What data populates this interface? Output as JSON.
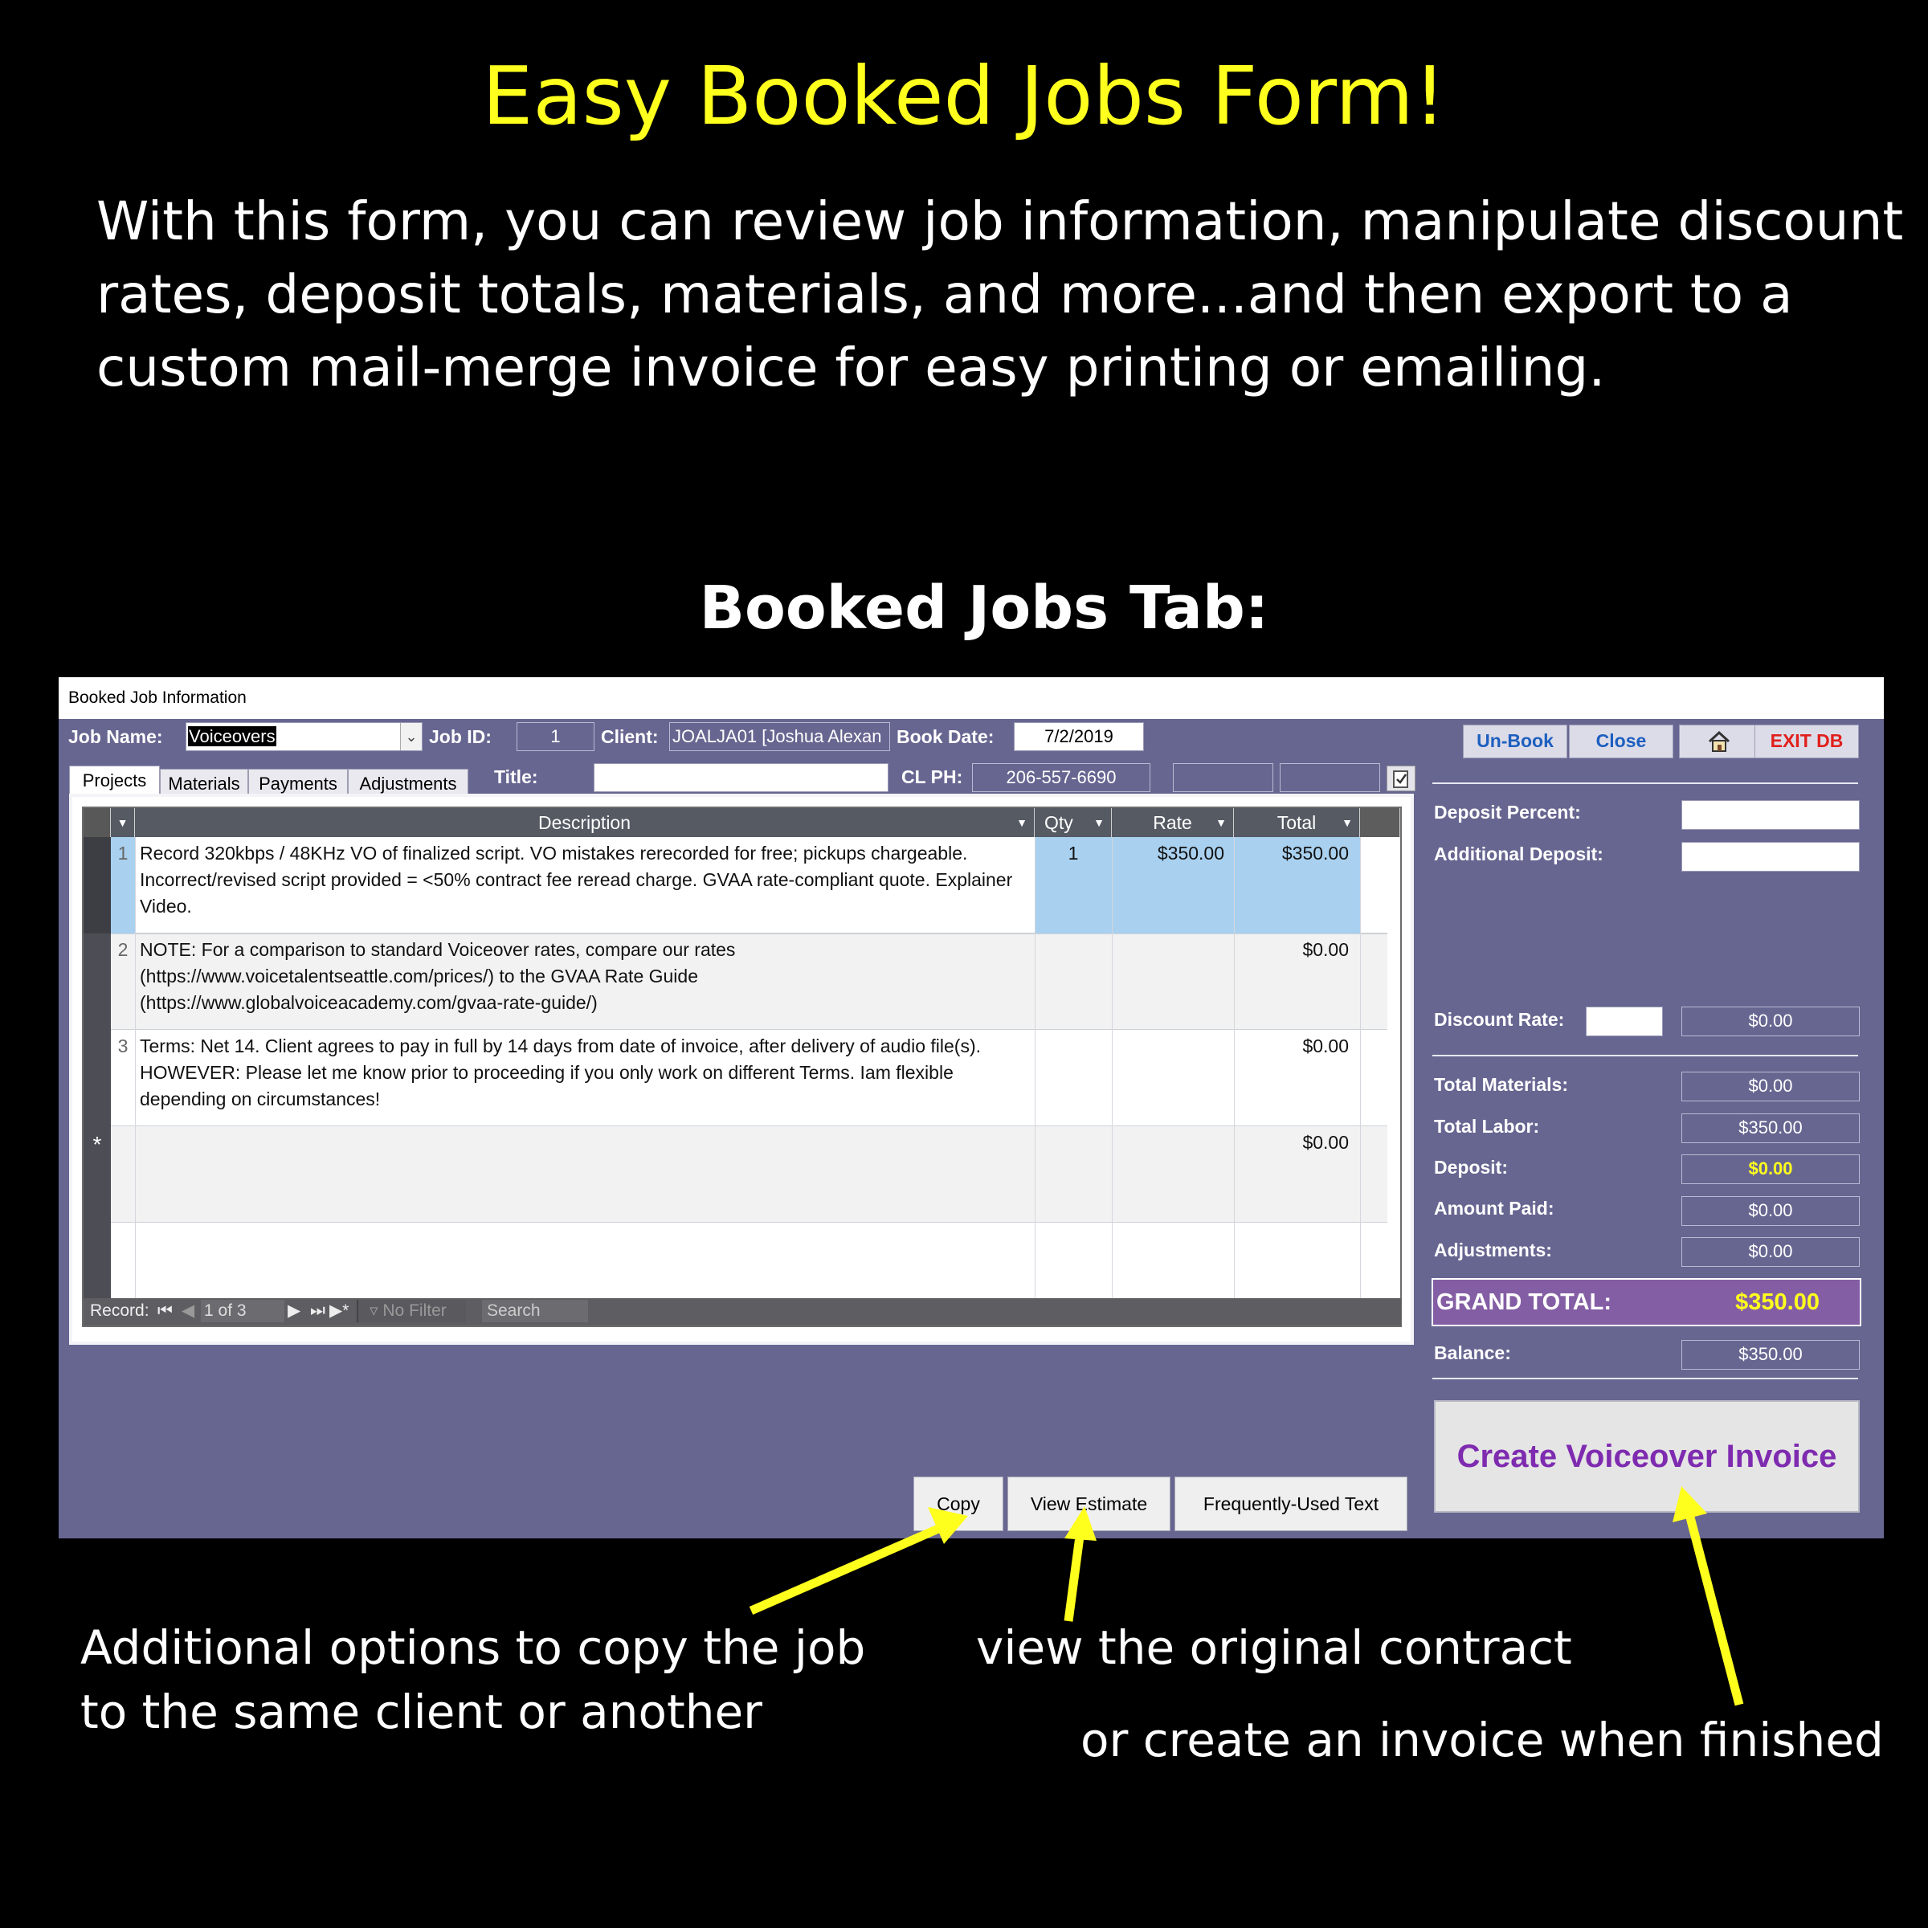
{
  "promo": {
    "title": "Easy Booked Jobs Form!",
    "intro_lines": [
      "With this form, you can review job information, manipulate discount",
      "rates, deposit totals, materials, and more...and then export to a",
      "custom mail-merge invoice for easy printing or emailing."
    ],
    "section_title": "Booked Jobs Tab:"
  },
  "window": {
    "title": "Booked Job Information",
    "header": {
      "job_name_label": "Job Name:",
      "job_name_value": "Voiceovers",
      "job_id_label": "Job ID:",
      "job_id_value": "1",
      "client_label": "Client:",
      "client_value": "JOALJA01 [Joshua Alexan",
      "book_date_label": "Book Date:",
      "book_date_value": "7/2/2019",
      "title_label": "Title:",
      "title_value": "",
      "cl_ph_label": "CL PH:",
      "cl_ph_value": "206-557-6690"
    },
    "top_buttons": {
      "unbook": "Un-Book",
      "close": "Close",
      "home_icon": "home-icon",
      "exit": "EXIT DB"
    },
    "tabs": [
      "Projects",
      "Materials",
      "Payments",
      "Adjustments"
    ],
    "grid": {
      "columns": [
        "Description",
        "Qty",
        "Rate",
        "Total"
      ],
      "rows": [
        {
          "num": "1",
          "description": "Record 320kbps / 48KHz VO of finalized script. VO mistakes rerecorded for free; pickups chargeable. Incorrect/revised script provided = <50% contract fee reread charge. GVAA rate-compliant quote. Explainer Video.",
          "qty": "1",
          "rate": "$350.00",
          "total": "$350.00"
        },
        {
          "num": "2",
          "description": "NOTE: For a comparison to standard Voiceover rates, compare our rates (https://www.voicetalentseattle.com/prices/) to the GVAA Rate Guide (https://www.globalvoiceacademy.com/gvaa-rate-guide/)",
          "qty": "",
          "rate": "",
          "total": "$0.00"
        },
        {
          "num": "3",
          "description": "Terms: Net 14.  Client agrees to pay in full by 14 days from date of invoice, after delivery of audio file(s). HOWEVER: Please let me know prior to proceeding if you only work on different Terms. Iam flexible depending on circumstances!",
          "qty": "",
          "rate": "",
          "total": "$0.00"
        }
      ],
      "new_row_marker": "*",
      "new_row_total": "$0.00"
    },
    "navigation": {
      "record_label": "Record:",
      "position": "1 of 3",
      "filter": "No Filter",
      "search": "Search"
    },
    "summary": {
      "deposit_percent_label": "Deposit Percent:",
      "deposit_percent_value": "",
      "additional_deposit_label": "Additional Deposit:",
      "additional_deposit_value": "",
      "discount_rate_label": "Discount Rate:",
      "discount_rate_value": "",
      "discount_amount": "$0.00",
      "total_materials_label": "Total Materials:",
      "total_materials_value": "$0.00",
      "total_labor_label": "Total Labor:",
      "total_labor_value": "$350.00",
      "deposit_label": "Deposit:",
      "deposit_value": "$0.00",
      "amount_paid_label": "Amount Paid:",
      "amount_paid_value": "$0.00",
      "adjustments_label": "Adjustments:",
      "adjustments_value": "$0.00",
      "grand_total_label": "GRAND TOTAL:",
      "grand_total_value": "$350.00",
      "balance_label": "Balance:",
      "balance_value": "$350.00"
    },
    "bottom_buttons": {
      "copy": "Copy",
      "view_estimate": "View Estimate",
      "frequently_used": "Frequently-Used Text",
      "create_invoice": "Create Voiceover Invoice"
    }
  },
  "annotations": {
    "copy_note_lines": [
      "Additional options to copy the job",
      "to the same client or another"
    ],
    "estimate_note": "view the original contract",
    "invoice_note": "or create an invoice when finished"
  },
  "colors": {
    "title_yellow": "#ffff1e",
    "window_purple": "#676691",
    "grand_total_bg": "#845ea4",
    "invoice_text": "#7e2bb0",
    "exit_red": "#e0201c",
    "link_blue": "#1d5fbf"
  }
}
